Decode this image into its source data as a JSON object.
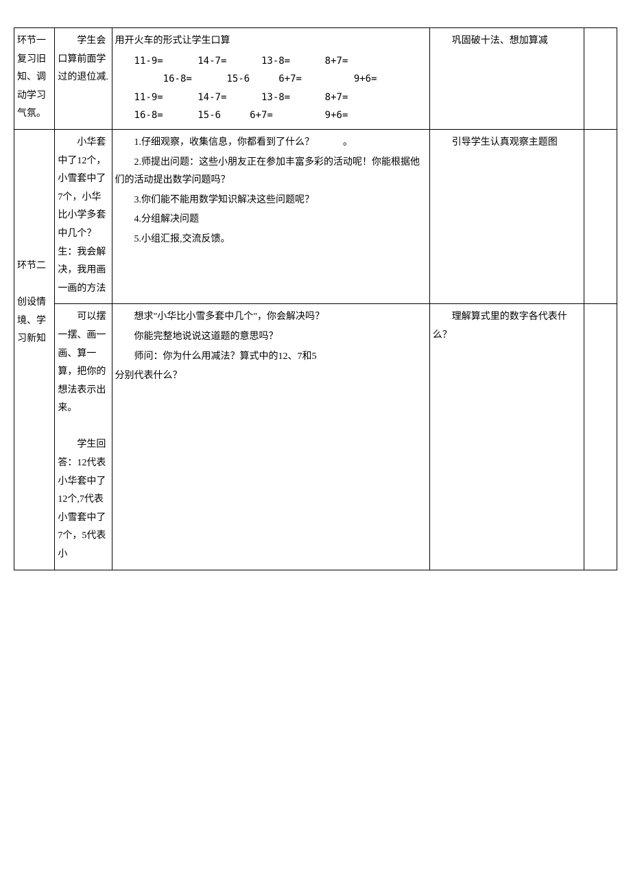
{
  "row1": {
    "col1": "环节一\n复习旧知、调动学习气氛。",
    "col2": "　　学生会口算前面学过的退位减.",
    "col3_intro": "用开火车的形式让学生口算",
    "eq1": "11-9=      14-7=      13-8=      8+7=",
    "eq2": "     16-8=      15-6     6+7=         9+6=",
    "eq3": "11-9=      14-7=      13-8=      8+7=",
    "eq4": "16-8=      15-6     6+7=         9+6=",
    "col4": "　　巩固破十法、想加算减"
  },
  "section2_col1": "环节二\n\n创设情境、学习新知",
  "row2a": {
    "col2": "　　小华套中了12个，小雪套中了7个，小华比小学多套中几个？生：我会解决，我用画一画的方法",
    "col3_1": "　　1.仔细观察，收集信息，你都看到了什么？　　　。",
    "col3_2": "　　2.师提出问题：这些小朋友正在参加丰富多彩的活动呢！你能根据他们的活动提出数学问题吗？",
    "col3_3": "　　3.你们能不能用数学知识解决这些问题呢？",
    "col3_4": "　　4.分组解决问题",
    "col3_5": "　　5.小组汇报,交流反馈。",
    "col4": "　　引导学生认真观察主题图"
  },
  "row2b": {
    "col2": "　　可以摆一摆、画一画、算一算，把你的想法表示出来。\n\n　　学生回答：12代表小华套中了12个,7代表小雪套中了7个，5代表小",
    "col3_1": "　　想求\"小华比小雪多套中几个\"，你会解决吗？",
    "col3_2": "　　你能完整地说说这道题的意思吗？",
    "col3_3": "　　师问：你为什么用减法？算式中的12、7和5",
    "col3_4": "分别代表什么？",
    "col4": "　　理解算式里的数字各代表什么？"
  }
}
